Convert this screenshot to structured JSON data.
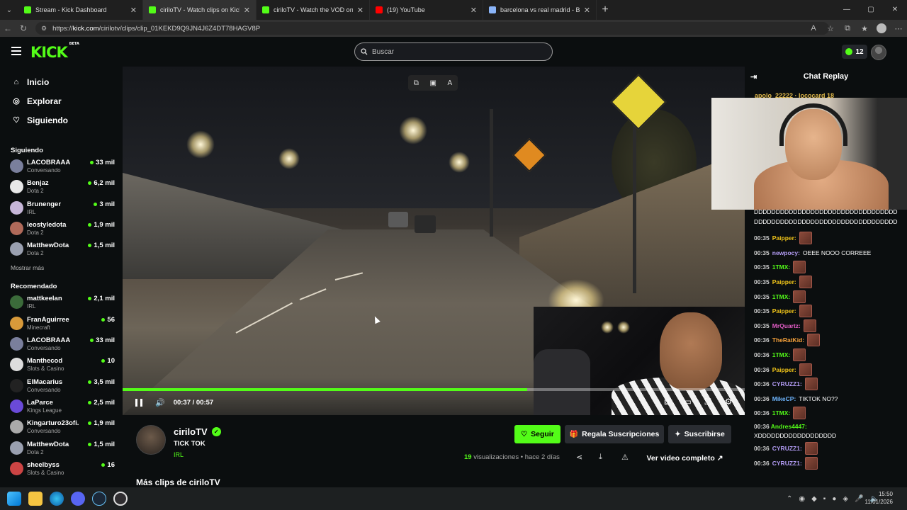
{
  "browser": {
    "tabs": [
      {
        "title": "Stream - Kick Dashboard",
        "favicon_color": "#53fc18"
      },
      {
        "title": "ciriloTV - Watch clips on Kick",
        "favicon_color": "#53fc18",
        "active": true
      },
      {
        "title": "ciriloTV - Watch the VOD on Kick",
        "favicon_color": "#53fc18"
      },
      {
        "title": "(19) YouTube",
        "favicon_color": "#ff0000"
      },
      {
        "title": "barcelona vs real madrid - Buscar",
        "favicon_color": "#8ab4f8"
      }
    ],
    "url_prefix": "https://",
    "url_host": "kick.com",
    "url_path": "/cirilotv/clips/clip_01KEKD9Q9JN4J6Z4DT78HAGV8P"
  },
  "header": {
    "logo": "KICK",
    "logo_tag": "BETA",
    "search_placeholder": "Buscar",
    "points": "12"
  },
  "sidebar": {
    "nav": [
      {
        "label": "Inicio",
        "icon": "home-icon"
      },
      {
        "label": "Explorar",
        "icon": "compass-icon"
      },
      {
        "label": "Siguiendo",
        "icon": "heart-icon"
      }
    ],
    "following_title": "Siguiendo",
    "following": [
      {
        "name": "LACOBRAAA",
        "category": "Conversando",
        "viewers": "33 mil",
        "color": "#7a7f9c"
      },
      {
        "name": "Benjaz",
        "category": "Dota 2",
        "viewers": "6,2 mil",
        "color": "#e8e8e8"
      },
      {
        "name": "Brunenger",
        "category": "IRL",
        "viewers": "3 mil",
        "color": "#c6b6d8"
      },
      {
        "name": "leostyledota",
        "category": "Dota 2",
        "viewers": "1,9 mil",
        "color": "#b06a5a"
      },
      {
        "name": "MatthewDota",
        "category": "Dota 2",
        "viewers": "1,5 mil",
        "color": "#9aa0b0"
      }
    ],
    "show_more": "Mostrar más",
    "recommended_title": "Recomendado",
    "recommended": [
      {
        "name": "mattkeelan",
        "category": "IRL",
        "viewers": "2,1 mil",
        "color": "#3b6b3a"
      },
      {
        "name": "FranAguirree",
        "category": "Minecraft",
        "viewers": "56",
        "color": "#d89a3a"
      },
      {
        "name": "LACOBRAAA",
        "category": "Conversando",
        "viewers": "33 mil",
        "color": "#7a7f9c"
      },
      {
        "name": "Manthecod",
        "category": "Slots & Casino",
        "viewers": "10",
        "color": "#ddd"
      },
      {
        "name": "ElMacarius",
        "category": "Conversando",
        "viewers": "3,5 mil",
        "color": "#222"
      },
      {
        "name": "LaParce",
        "category": "Kings League",
        "viewers": "2,5 mil",
        "color": "#6a4ad8"
      },
      {
        "name": "Kingarturo23ofi...",
        "category": "Conversando",
        "viewers": "1,9 mil",
        "color": "#aaa"
      },
      {
        "name": "MatthewDota",
        "category": "Dota 2",
        "viewers": "1,5 mil",
        "color": "#9aa0b0"
      },
      {
        "name": "sheelbyss",
        "category": "Slots & Casino",
        "viewers": "16",
        "color": "#c44"
      }
    ]
  },
  "player": {
    "time": "00:37 / 00:57",
    "progress": 0.65
  },
  "clip": {
    "channel": "ciriloTV",
    "title": "TICK TOK",
    "category": "IRL",
    "views_count": "19",
    "views_label": "visualizaciones",
    "age": "hace 2 días",
    "follow": "Seguir",
    "gift": "Regala Suscripciones",
    "subscribe": "Suscribirse",
    "full_video": "Ver video completo",
    "more_clips": "Más clips de ciriloTV"
  },
  "chat": {
    "title": "Chat Replay",
    "top_partial": "apolo_22222 · lococard 18",
    "spam_text": "DDDDDDDDDDDDDDDDDDDDDDDDDDDDDDDDDDDDDDDDDDDDDDDDDDDDDDDDDDDDDDDDDD",
    "messages": [
      {
        "time": "00:35",
        "user": "Paipper:",
        "color": "#f0c419",
        "emote": true
      },
      {
        "time": "00:35",
        "user": "newpocy:",
        "color": "#b39cf5",
        "text": "OEEE NOOO CORREEE"
      },
      {
        "time": "00:35",
        "user": "1TMX:",
        "color": "#53fc18",
        "emote": true
      },
      {
        "time": "00:35",
        "user": "Paipper:",
        "color": "#f0c419",
        "emote": true
      },
      {
        "time": "00:35",
        "user": "1TMX:",
        "color": "#53fc18",
        "emote": true
      },
      {
        "time": "00:35",
        "user": "Paipper:",
        "color": "#f0c419",
        "emote": true
      },
      {
        "time": "00:35",
        "user": "MrQuartz:",
        "color": "#e05cc4",
        "emote": true
      },
      {
        "time": "00:36",
        "user": "TheRatKid:",
        "color": "#f7a23b",
        "emote": true
      },
      {
        "time": "00:36",
        "user": "1TMX:",
        "color": "#53fc18",
        "emote": true
      },
      {
        "time": "00:36",
        "user": "Paipper:",
        "color": "#f0c419",
        "emote": true
      },
      {
        "time": "00:36",
        "user": "CYRUZZ1:",
        "color": "#b39cf5",
        "emote": true
      },
      {
        "time": "00:36",
        "user": "MikeCP:",
        "color": "#6fb6ff",
        "text": "TIKTOK NO??"
      },
      {
        "time": "00:36",
        "user": "1TMX:",
        "color": "#53fc18",
        "emote": true
      }
    ],
    "andres": {
      "time": "00:36",
      "user": "Andres4447:",
      "color": "#53fc18",
      "text": "XDDDDDDDDDDDDDDDDDD"
    },
    "tail": [
      {
        "time": "00:36",
        "user": "CYRUZZ1:",
        "color": "#b39cf5",
        "emote": true
      },
      {
        "time": "00:36",
        "user": "CYRUZZ1:",
        "color": "#b39cf5",
        "emote": true
      }
    ]
  },
  "taskbar": {
    "time": "15:50",
    "date": "11/01/2026"
  }
}
